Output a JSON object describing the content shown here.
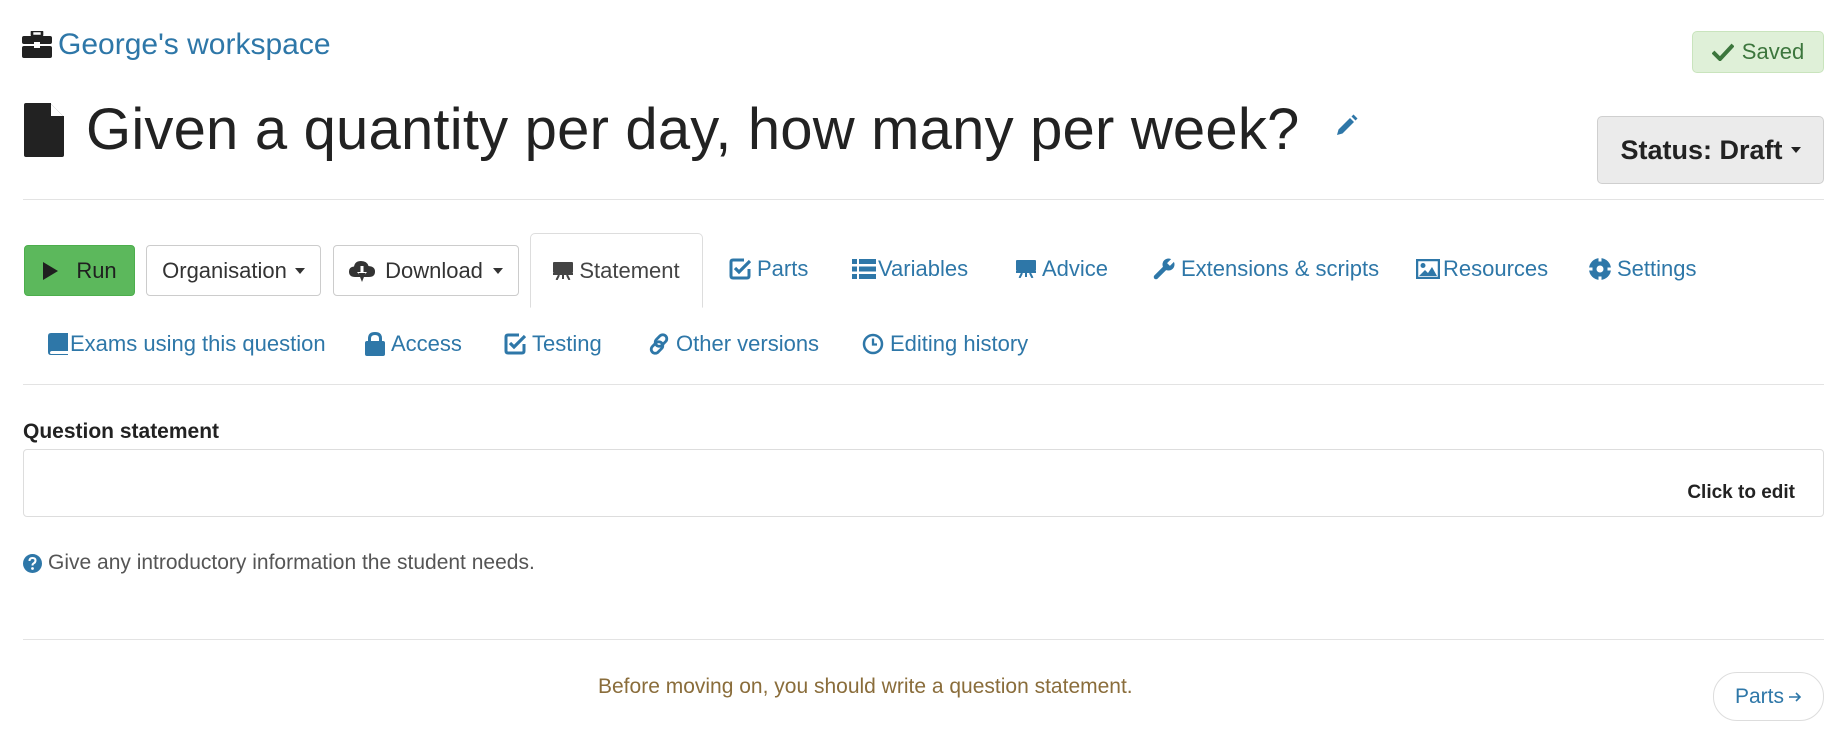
{
  "header": {
    "workspace_icon": "briefcase-icon",
    "workspace_link": "George's workspace",
    "saved_icon": "check-icon",
    "saved_label": "Saved",
    "title_icon": "file-icon",
    "title": "Given a quantity per day, how many per week?",
    "edit_icon": "pencil-icon",
    "status_label": "Status: Draft"
  },
  "toolbar": {
    "run_label": "Run",
    "organisation_label": "Organisation",
    "download_label": "Download"
  },
  "tabs": {
    "statement": "Statement",
    "parts": "Parts",
    "variables": "Variables",
    "advice": "Advice",
    "extensions": "Extensions & scripts",
    "resources": "Resources",
    "settings": "Settings",
    "exams": "Exams using this question",
    "access": "Access",
    "testing": "Testing",
    "other_versions": "Other versions",
    "editing_history": "Editing history"
  },
  "statement": {
    "title": "Question statement",
    "click_to_edit": "Click to edit",
    "help_text": "Give any introductory information the student needs."
  },
  "footer": {
    "warning": "Before moving on, you should write a question statement.",
    "next_label": "Parts"
  },
  "colors": {
    "link": "#2e77a8",
    "run_button": "#5cb85c",
    "saved_bg": "#dff0d8",
    "saved_text": "#3c763d",
    "warning_text": "#8a6d3b"
  }
}
